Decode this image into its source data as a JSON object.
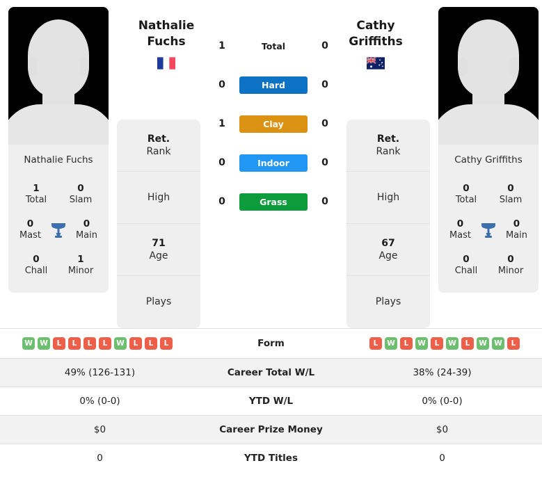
{
  "players": {
    "left": {
      "first_name": "Nathalie",
      "last_name": "Fuchs",
      "full_name": "Nathalie Fuchs",
      "flag": "fr-flag-icon",
      "country": "France",
      "photo": "player-silhouette-placeholder",
      "titles": [
        {
          "value": "1",
          "label": "Total"
        },
        {
          "value": "0",
          "label": "Slam"
        },
        {
          "value": "0",
          "label": "Mast"
        },
        {
          "value": "0",
          "label": "Main"
        },
        {
          "value": "0",
          "label": "Chall"
        },
        {
          "value": "1",
          "label": "Minor"
        }
      ],
      "info": [
        {
          "value": "Ret.",
          "label": "Rank"
        },
        {
          "value": "",
          "label": "High"
        },
        {
          "value": "71",
          "label": "Age"
        },
        {
          "value": "",
          "label": "Plays"
        }
      ],
      "surface_scores": {
        "total": "1",
        "hard": "0",
        "clay": "1",
        "indoor": "0",
        "grass": "0"
      },
      "form": [
        "W",
        "W",
        "L",
        "L",
        "L",
        "L",
        "W",
        "L",
        "L",
        "L"
      ],
      "career_total_wl": "49% (126-131)",
      "ytd_wl": "0% (0-0)",
      "career_prize_money": "$0",
      "ytd_titles": "0"
    },
    "right": {
      "first_name": "Cathy",
      "last_name": "Griffiths",
      "full_name": "Cathy Griffiths",
      "flag": "au-flag-icon",
      "country": "Australia",
      "photo": "player-silhouette-placeholder",
      "titles": [
        {
          "value": "0",
          "label": "Total"
        },
        {
          "value": "0",
          "label": "Slam"
        },
        {
          "value": "0",
          "label": "Mast"
        },
        {
          "value": "0",
          "label": "Main"
        },
        {
          "value": "0",
          "label": "Chall"
        },
        {
          "value": "0",
          "label": "Minor"
        }
      ],
      "info": [
        {
          "value": "Ret.",
          "label": "Rank"
        },
        {
          "value": "",
          "label": "High"
        },
        {
          "value": "67",
          "label": "Age"
        },
        {
          "value": "",
          "label": "Plays"
        }
      ],
      "surface_scores": {
        "total": "0",
        "hard": "0",
        "clay": "0",
        "indoor": "0",
        "grass": "0"
      },
      "form": [
        "L",
        "W",
        "L",
        "W",
        "L",
        "W",
        "L",
        "W",
        "W",
        "L"
      ],
      "career_total_wl": "38% (24-39)",
      "ytd_wl": "0% (0-0)",
      "career_prize_money": "$0",
      "ytd_titles": "0"
    }
  },
  "surfaces": [
    {
      "key": "total",
      "label": "Total",
      "color": "transparent",
      "plain": true
    },
    {
      "key": "hard",
      "label": "Hard",
      "color": "#0e72c4",
      "plain": false
    },
    {
      "key": "clay",
      "label": "Clay",
      "color": "#db9212",
      "plain": false
    },
    {
      "key": "indoor",
      "label": "Indoor",
      "color": "#2196f3",
      "plain": false
    },
    {
      "key": "grass",
      "label": "Grass",
      "color": "#0c9c3c",
      "plain": false
    }
  ],
  "table_rows": [
    {
      "label": "Form",
      "type": "form"
    },
    {
      "label": "Career Total W/L",
      "type": "text",
      "field": "career_total_wl"
    },
    {
      "label": "YTD W/L",
      "type": "text",
      "field": "ytd_wl"
    },
    {
      "label": "Career Prize Money",
      "type": "text",
      "field": "career_prize_money"
    },
    {
      "label": "YTD Titles",
      "type": "text",
      "field": "ytd_titles"
    }
  ],
  "colors": {
    "win_badge": "#6cbf6e",
    "loss_badge": "#ee5f4a",
    "hard": "#0e72c4",
    "clay": "#db9212",
    "indoor": "#2196f3",
    "grass": "#0c9c3c",
    "trophy": "#3d6fad",
    "card_bg": "#efefef",
    "row_alt_bg": "#f2f2f2"
  },
  "icons": {
    "trophy": "trophy-icon"
  }
}
